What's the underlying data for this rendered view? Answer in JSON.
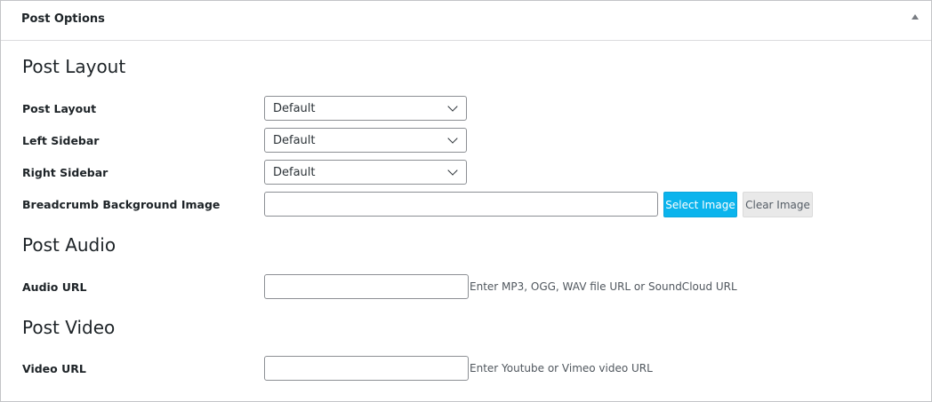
{
  "panel": {
    "title": "Post Options",
    "toggle_icon": "triangle-up-icon"
  },
  "sections": {
    "layout": {
      "heading": "Post Layout",
      "post_layout": {
        "label": "Post Layout",
        "value": "Default"
      },
      "left_sidebar": {
        "label": "Left Sidebar",
        "value": "Default"
      },
      "right_sidebar": {
        "label": "Right Sidebar",
        "value": "Default"
      },
      "breadcrumb": {
        "label": "Breadcrumb Background Image",
        "value": "",
        "select_label": "Select Image",
        "clear_label": "Clear Image"
      }
    },
    "audio": {
      "heading": "Post Audio",
      "label": "Audio URL",
      "value": "",
      "help": "Enter MP3, OGG, WAV file URL or SoundCloud URL"
    },
    "video": {
      "heading": "Post Video",
      "label": "Video URL",
      "value": "",
      "help": "Enter Youtube or Vimeo video URL"
    }
  },
  "colors": {
    "accent": "#0bb4ed",
    "border": "#8c8f94",
    "secondary_button": "#e9e9e9"
  }
}
